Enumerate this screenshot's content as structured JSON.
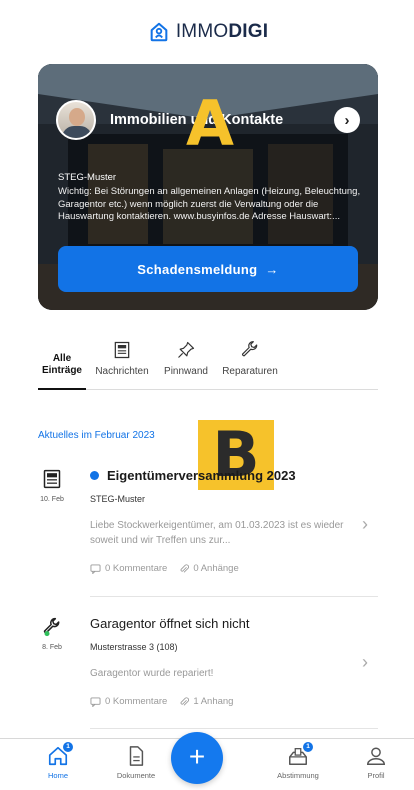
{
  "app": {
    "logo_prefix": "IMMO",
    "logo_suffix": "DIGI"
  },
  "hero": {
    "title": "Immobilien und Kontakte",
    "org": "STEG-Muster",
    "note": "Wichtig: Bei Störungen an allgemeinen Anlagen (Heizung, Beleuchtung, Garagentor etc.) wenn möglich zuerst die Verwaltung oder die Hauswartung kontaktieren. www.busyinfos.de Adresse Hauswart:...",
    "button_label": "Schadensmeldung",
    "button_arrow": "→",
    "overlay_label": "A"
  },
  "tabs": [
    {
      "label": "Alle\nEinträge",
      "active": true
    },
    {
      "label": "Nachrichten",
      "icon": "news-icon"
    },
    {
      "label": "Pinnwand",
      "icon": "pin-icon"
    },
    {
      "label": "Reparaturen",
      "icon": "wrench-icon"
    }
  ],
  "section": {
    "title": "Aktuelles im Februar 2023",
    "overlay_label": "B"
  },
  "entries": [
    {
      "date": "10. Feb",
      "title": "Eigentümerversammlung 2023",
      "author": "STEG-Muster",
      "text": "Liebe Stockwerkeigentümer, am 01.03.2023 ist es wieder soweit und wir Treffen uns zur...",
      "comments": "0 Kommentare",
      "attachments": "0 Anhänge",
      "unread": true
    },
    {
      "date": "8. Feb",
      "title": "Garagentor öffnet sich nicht",
      "author": "Musterstrasse 3 (108)",
      "text": "Garagentor wurde repariert!",
      "comments": "0 Kommentare",
      "attachments": "1 Anhang",
      "unread": false
    }
  ],
  "nav": {
    "home": "Home",
    "home_badge": "1",
    "documents": "Dokumente",
    "fab": "+",
    "vote": "Abstimmung",
    "vote_badge": "1",
    "profile": "Profil"
  },
  "colors": {
    "accent": "#1273e6",
    "overlay": "#f6c22b"
  }
}
